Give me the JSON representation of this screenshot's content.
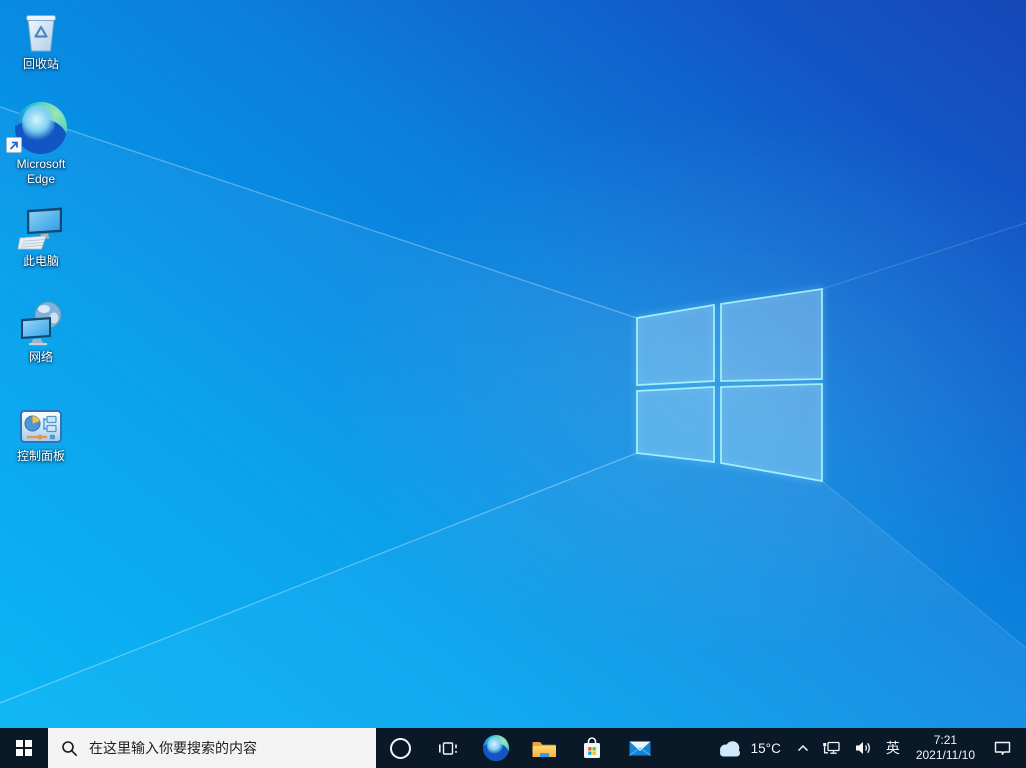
{
  "desktop_icons": [
    {
      "label": "回收站"
    },
    {
      "label": "Microsoft Edge"
    },
    {
      "label": "此电脑"
    },
    {
      "label": "网络"
    },
    {
      "label": "控制面板"
    }
  ],
  "taskbar": {
    "search_placeholder": "在这里输入你要搜索的内容",
    "tray": {
      "temperature": "15°C",
      "language": "英",
      "time": "7:21",
      "date": "2021/11/10"
    }
  },
  "colors": {
    "wallpaper_bottom_left": "#00b5f5",
    "wallpaper_top_right": "#1747b7",
    "taskbar_background": "#0a1928",
    "search_box_background": "#f3f3f3",
    "logo_edge_glow": "#a0f0ff",
    "folder_yellow": "#fcc43e",
    "mail_blue": "#1583d6",
    "store_red": "#f25022",
    "store_green": "#7fba00",
    "store_blue": "#00a4ef",
    "store_yellow": "#ffb900"
  }
}
